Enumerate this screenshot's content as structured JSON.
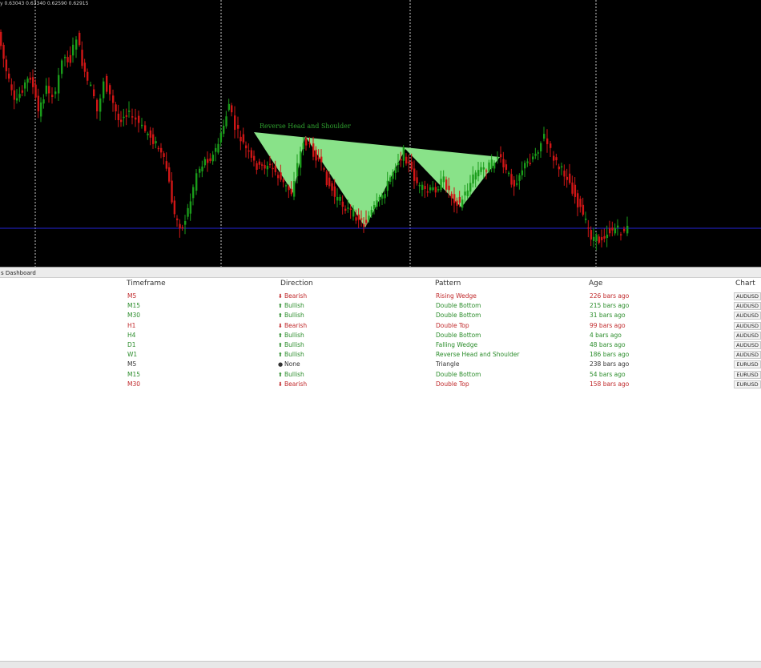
{
  "chart": {
    "ohlc_label": "y  0.63043 0.63340 0.62590 0.62915",
    "pattern_label": "Reverse Head and Shoulder",
    "colors": {
      "background": "#000000",
      "bull_candle": "#1a9c1a",
      "bear_candle": "#d01616",
      "pattern_fill": "#90ee90",
      "support_line": "#2323d8",
      "separator": "#c8c8c8"
    }
  },
  "dashboard": {
    "title": "s Dashboard",
    "headers": {
      "timeframe": "Timeframe",
      "direction": "Direction",
      "pattern": "Pattern",
      "age": "Age",
      "chart": "Chart"
    },
    "rows": [
      {
        "timeframe": "M5",
        "direction": "Bearish",
        "dir_icon": "arrow-down-icon",
        "pattern": "Rising Wedge",
        "age": "226 bars ago",
        "symbol": "AUDUSD",
        "sentiment": "bear"
      },
      {
        "timeframe": "M15",
        "direction": "Bullish",
        "dir_icon": "arrow-up-icon",
        "pattern": "Double Bottom",
        "age": "215 bars ago",
        "symbol": "AUDUSD",
        "sentiment": "bull"
      },
      {
        "timeframe": "M30",
        "direction": "Bullish",
        "dir_icon": "arrow-up-icon",
        "pattern": "Double Bottom",
        "age": "31 bars ago",
        "symbol": "AUDUSD",
        "sentiment": "bull"
      },
      {
        "timeframe": "H1",
        "direction": "Bearish",
        "dir_icon": "arrow-down-icon",
        "pattern": "Double Top",
        "age": "99 bars ago",
        "symbol": "AUDUSD",
        "sentiment": "bear"
      },
      {
        "timeframe": "H4",
        "direction": "Bullish",
        "dir_icon": "arrow-up-icon",
        "pattern": "Double Bottom",
        "age": "4 bars ago",
        "symbol": "AUDUSD",
        "sentiment": "bull"
      },
      {
        "timeframe": "D1",
        "direction": "Bullish",
        "dir_icon": "arrow-up-icon",
        "pattern": "Falling Wedge",
        "age": "48 bars ago",
        "symbol": "AUDUSD",
        "sentiment": "bull"
      },
      {
        "timeframe": "W1",
        "direction": "Bullish",
        "dir_icon": "arrow-up-icon",
        "pattern": "Reverse Head and Shoulder",
        "age": "186 bars ago",
        "symbol": "AUDUSD",
        "sentiment": "bull"
      },
      {
        "timeframe": "M5",
        "direction": "None",
        "dir_icon": "dot-icon",
        "pattern": "Triangle",
        "age": "238 bars ago",
        "symbol": "EURUSD",
        "sentiment": "neutral"
      },
      {
        "timeframe": "M15",
        "direction": "Bullish",
        "dir_icon": "arrow-up-icon",
        "pattern": "Double Bottom",
        "age": "54 bars ago",
        "symbol": "EURUSD",
        "sentiment": "bull"
      },
      {
        "timeframe": "M30",
        "direction": "Bearish",
        "dir_icon": "arrow-down-icon",
        "pattern": "Double Top",
        "age": "158 bars ago",
        "symbol": "EURUSD",
        "sentiment": "bear"
      }
    ]
  }
}
